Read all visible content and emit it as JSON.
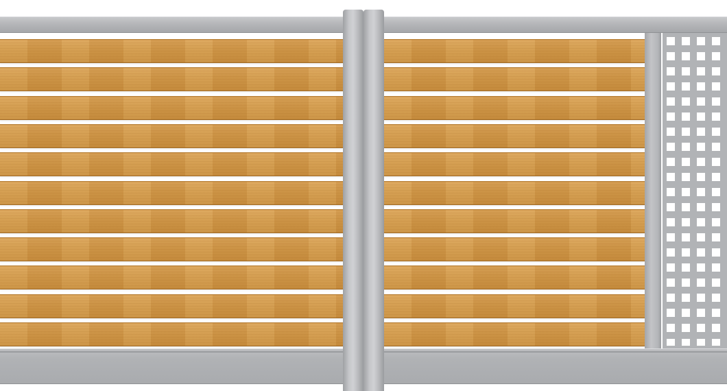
{
  "scene": {
    "description_free": true,
    "materials": {
      "frame_color": "#b5b6b9",
      "wood_color": "#d29a4c",
      "panel_color": "#b1b3b6"
    },
    "left_gate": {
      "slat_count": 11
    },
    "right_gate": {
      "slat_count": 11,
      "perforated_panel": true
    }
  }
}
